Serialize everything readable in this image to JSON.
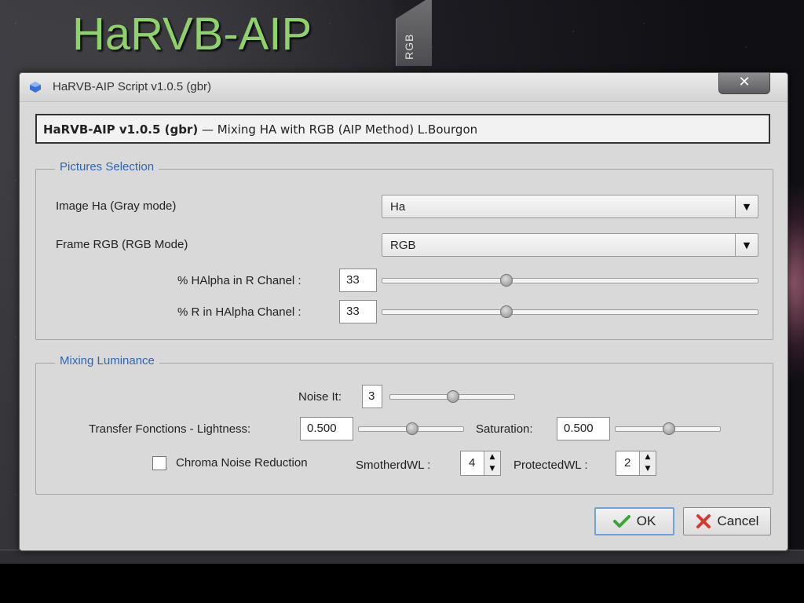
{
  "slide": {
    "title": "HaRVB-AIP"
  },
  "side_tab": {
    "label": "RGB"
  },
  "window": {
    "title": "HaRVB-AIP Script v1.0.5 (gbr)",
    "close_label": "✕"
  },
  "header": {
    "bold": "HaRVB-AIP v1.0.5 (gbr)",
    "rest": " — Mixing HA with RGB (AIP Method) L.Bourgon"
  },
  "pictures": {
    "legend": "Pictures Selection",
    "image_ha_label": "Image Ha (Gray mode)",
    "image_ha_value": "Ha",
    "frame_rgb_label": "Frame RGB (RGB Mode)",
    "frame_rgb_value": "RGB",
    "halpha_r_label": "% HAlpha in R Chanel :",
    "halpha_r_value": "33",
    "halpha_r_level": 0.33,
    "r_halpha_label": "% R in HAlpha Chanel :",
    "r_halpha_value": "33",
    "r_halpha_level": 0.33
  },
  "mixing": {
    "legend": "Mixing Luminance",
    "noise_label": "Noise It:",
    "noise_value": "3",
    "noise_level": 0.5,
    "lightness_label": "Transfer Fonctions - Lightness:",
    "lightness_value": "0.500",
    "lightness_level": 0.5,
    "saturation_label": "Saturation:",
    "saturation_value": "0.500",
    "saturation_level": 0.5,
    "chroma_label": "Chroma Noise Reduction",
    "chroma_checked": false,
    "smothered_label": "SmotherdWL :",
    "smothered_value": "4",
    "protected_label": "ProtectedWL :",
    "protected_value": "2"
  },
  "buttons": {
    "ok": "OK",
    "cancel": "Cancel"
  },
  "colors": {
    "title_green": "#8fd16a",
    "legend_blue": "#3265b0",
    "ok_check": "#3ea33a",
    "cancel_x": "#d63a2f"
  }
}
